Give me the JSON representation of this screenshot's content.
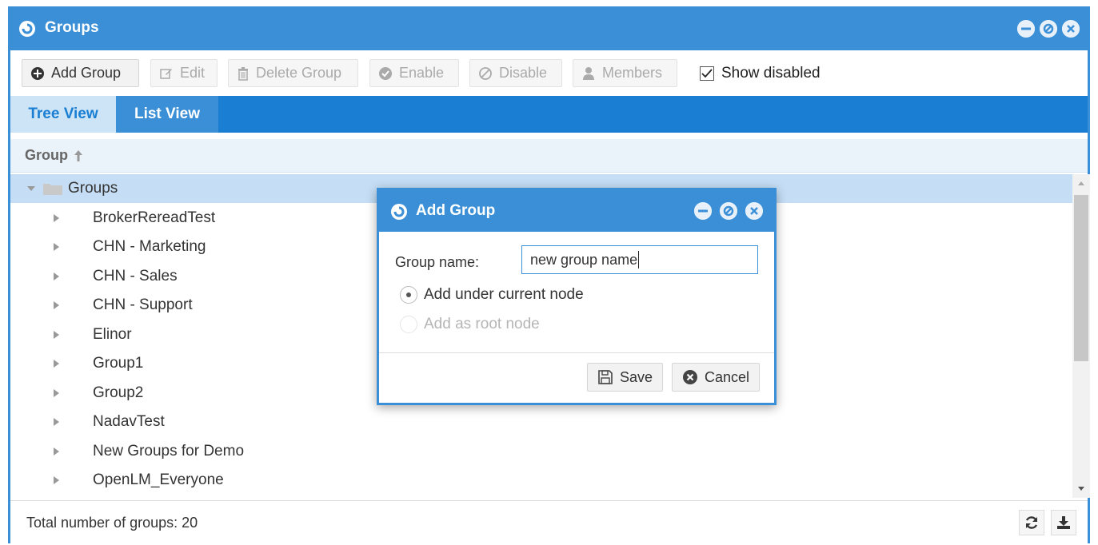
{
  "window": {
    "title": "Groups",
    "accent_color": "#3a8fd6",
    "controls": [
      "minimize-icon",
      "restore-icon",
      "close-icon"
    ]
  },
  "toolbar": {
    "add_group": "Add Group",
    "edit": "Edit",
    "delete_group": "Delete Group",
    "enable": "Enable",
    "disable": "Disable",
    "members": "Members",
    "show_disabled": "Show disabled",
    "show_disabled_checked": true
  },
  "tabs": [
    {
      "label": "Tree View",
      "active": true
    },
    {
      "label": "List View",
      "active": false
    }
  ],
  "grid": {
    "column_header": "Group",
    "sort": "ascending",
    "root": "Groups",
    "items": [
      "BrokerRereadTest",
      "CHN - Marketing",
      "CHN - Sales",
      "CHN - Support",
      "Elinor",
      "Group1",
      "Group2",
      "NadavTest",
      "New Groups for Demo",
      "OpenLM_Everyone"
    ]
  },
  "footer": {
    "total_text": "Total number of groups: 20"
  },
  "dialog": {
    "title": "Add Group",
    "group_name_label": "Group name:",
    "group_name_value": "new group name",
    "option_current": "Add under current node",
    "option_root": "Add as root node",
    "selected_option": "current",
    "save": "Save",
    "cancel": "Cancel"
  }
}
